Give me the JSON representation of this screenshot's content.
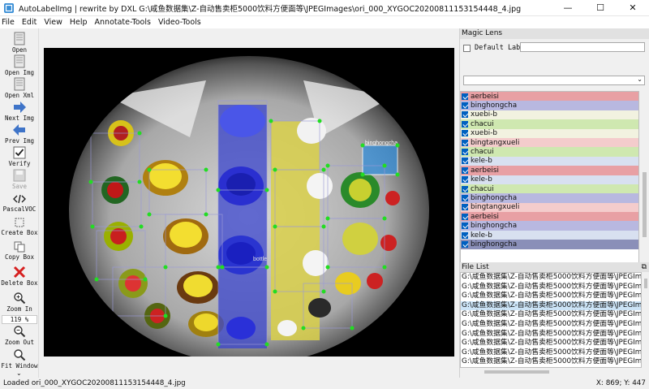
{
  "window": {
    "title": "AutoLabelImg | rewrite by DXL G:\\咸鱼数据集\\Z-自动售卖柜5000饮料方便面等\\JPEGImages\\ori_000_XYGOC20200811153154448_4.jpg",
    "minimize": "—",
    "maximize": "☐",
    "close": "✕"
  },
  "menu": [
    "File",
    "Edit",
    "View",
    "Help",
    "Annotate-Tools",
    "Video-Tools"
  ],
  "toolbar": {
    "open": "Open",
    "open_img": "Open Img",
    "open_xml": "Open Xml",
    "next_img": "Next Img",
    "prev_img": "Prev Img",
    "verify": "Verify",
    "save": "Save",
    "format": "PascalVOC",
    "create_box": "Create Box",
    "copy_box": "Copy Box",
    "delete_box": "Delete Box",
    "zoom_in": "Zoom In",
    "zoom_value": "119 %",
    "zoom_out": "Zoom Out",
    "fit_window": "Fit Window"
  },
  "magic_lens": {
    "title": "Magic Lens",
    "default_label": "Default Label",
    "default_label_value": "",
    "dropdown_value": ""
  },
  "labels": [
    {
      "name": "aerbeisi",
      "color": "#e8a0a4"
    },
    {
      "name": "binghongcha",
      "color": "#b8b8e0"
    },
    {
      "name": "xuebi-b",
      "color": "#f2f2e0"
    },
    {
      "name": "chacui",
      "color": "#cfe8b0"
    },
    {
      "name": "xuebi-b",
      "color": "#f2f2e0"
    },
    {
      "name": "bingtangxueli",
      "color": "#f4cccc"
    },
    {
      "name": "chacui",
      "color": "#cfe8b0"
    },
    {
      "name": "kele-b",
      "color": "#d8e0f0"
    },
    {
      "name": "aerbeisi",
      "color": "#e8a0a4"
    },
    {
      "name": "kele-b",
      "color": "#d8e0f0"
    },
    {
      "name": "chacui",
      "color": "#cfe8b0"
    },
    {
      "name": "binghongcha",
      "color": "#b8b8e0"
    },
    {
      "name": "bingtangxueli",
      "color": "#f4cccc"
    },
    {
      "name": "aerbeisi",
      "color": "#e8a0a4"
    },
    {
      "name": "binghongcha",
      "color": "#b8b8e0"
    },
    {
      "name": "kele-b",
      "color": "#d8e0f0"
    },
    {
      "name": "binghongcha",
      "color": "#8a8fb8"
    }
  ],
  "file_list": {
    "title": "File List",
    "files": [
      "G:\\咸鱼数据集\\Z-自动售卖柜5000饮料方便面等\\JPEGImages\\",
      "G:\\咸鱼数据集\\Z-自动售卖柜5000饮料方便面等\\JPEGImages\\",
      "G:\\咸鱼数据集\\Z-自动售卖柜5000饮料方便面等\\JPEGImages\\",
      "G:\\咸鱼数据集\\Z-自动售卖柜5000饮料方便面等\\JPEGImages\\",
      "G:\\咸鱼数据集\\Z-自动售卖柜5000饮料方便面等\\JPEGImages\\",
      "G:\\咸鱼数据集\\Z-自动售卖柜5000饮料方便面等\\JPEGImages\\",
      "G:\\咸鱼数据集\\Z-自动售卖柜5000饮料方便面等\\JPEGImages\\",
      "G:\\咸鱼数据集\\Z-自动售卖柜5000饮料方便面等\\JPEGImages\\",
      "G:\\咸鱼数据集\\Z-自动售卖柜5000饮料方便面等\\JPEGImages\\",
      "G:\\咸鱼数据集\\Z-自动售卖柜5000饮料方便面等\\JPEGImages\\"
    ]
  },
  "canvas": {
    "box_label_selected": "binghongcha",
    "box_label_bottle": "bottle"
  },
  "status": {
    "message": "Loaded ori_000_XYGOC20200811153154448_4.jpg",
    "coords": "X: 869; Y: 447"
  }
}
